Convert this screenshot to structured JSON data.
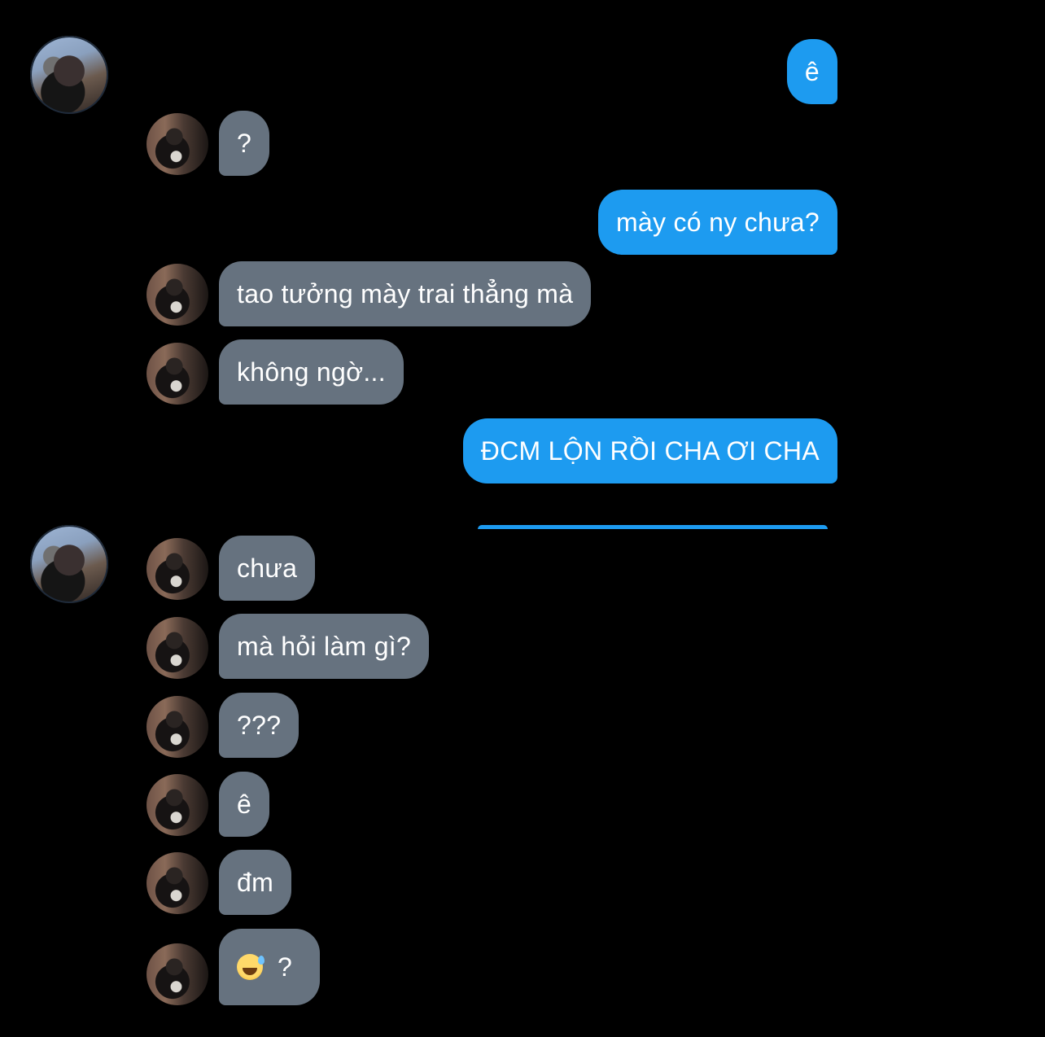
{
  "messages": [
    {
      "side": "out",
      "text": "ê"
    },
    {
      "side": "in",
      "text": "?"
    },
    {
      "side": "out",
      "text": "mày có ny chưa?"
    },
    {
      "side": "in",
      "text": "tao tưởng mày trai thẳng mà"
    },
    {
      "side": "in",
      "text": "không ngờ..."
    },
    {
      "side": "out",
      "text": "ĐCM LỘN RỒI CHA ƠI CHA"
    },
    {
      "side": "in",
      "text": "chưa"
    },
    {
      "side": "in",
      "text": "mà hỏi làm gì?"
    },
    {
      "side": "in",
      "text": "???"
    },
    {
      "side": "in",
      "text": "ê"
    },
    {
      "side": "in",
      "text": "đm"
    },
    {
      "side": "in",
      "emoji": "sweat-smile-emoji",
      "text": "?"
    }
  ]
}
